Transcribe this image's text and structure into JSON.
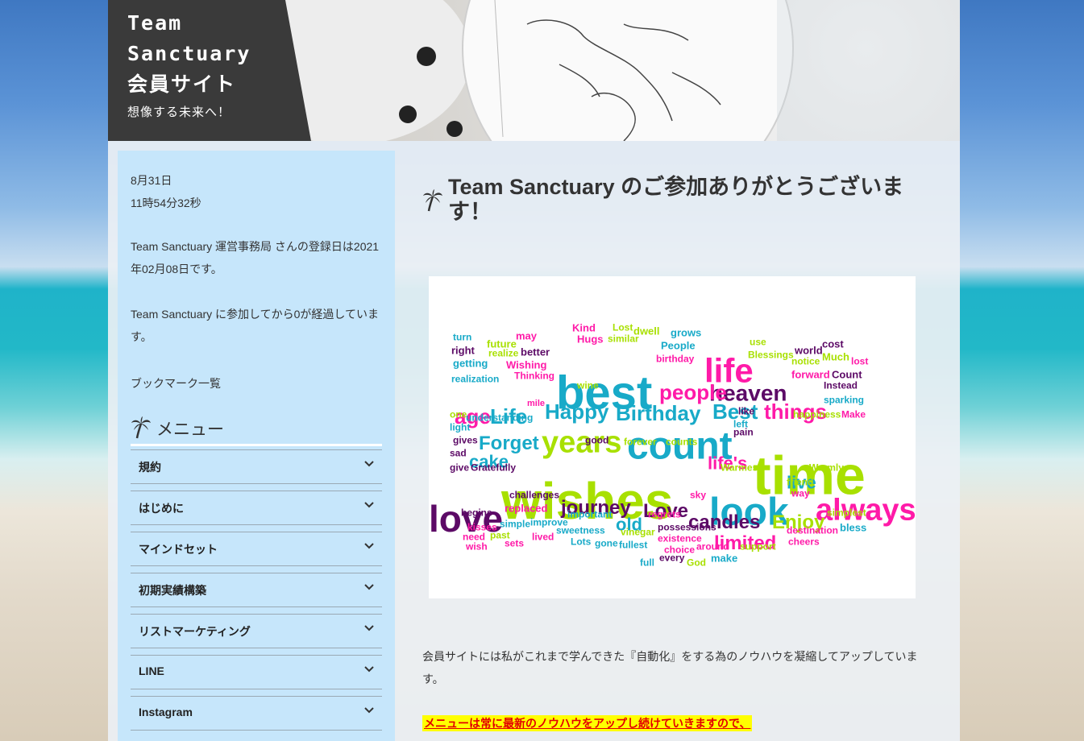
{
  "header": {
    "site_title": "Team\nSanctuary\n会員サイト",
    "tagline": "想像する未来へ！"
  },
  "sidebar": {
    "date": "8月31日",
    "time": "11時54分32秒",
    "registration": "Team Sanctuary 運営事務局 さんの登録日は2021年02月08日です。",
    "elapsed": "Team Sanctuary に参加してから0が経過しています。",
    "bookmarks": "ブックマーク一覧",
    "menu_heading": "メニュー",
    "menu_items": [
      {
        "label": "規約"
      },
      {
        "label": "はじめに"
      },
      {
        "label": "マインドセット"
      },
      {
        "label": "初期実績構築"
      },
      {
        "label": "リストマーケティング"
      },
      {
        "label": "LINE"
      },
      {
        "label": "Instagram"
      }
    ]
  },
  "main": {
    "post_title": "Team Sanctuary のご参加ありがとうございます！",
    "body": "会員サイトには私がこれまで学んできた『自動化』をする為のノウハウを凝縮してアップしています。",
    "highlight": "メニューは常に最新のノウハウをアップし続けていきますので、"
  },
  "wordcloud": {
    "words": [
      {
        "t": "wishes",
        "c": "#a8e000"
      },
      {
        "t": "time",
        "c": "#a8e000"
      },
      {
        "t": "best",
        "c": "#18aac8"
      },
      {
        "t": "love",
        "c": "#5c0a66"
      },
      {
        "t": "look",
        "c": "#18aac8"
      },
      {
        "t": "count",
        "c": "#18aac8"
      },
      {
        "t": "life",
        "c": "#ff1aa8"
      },
      {
        "t": "years",
        "c": "#a8e000"
      },
      {
        "t": "always",
        "c": "#ff1aa8"
      },
      {
        "t": "heaven",
        "c": "#5c0a66"
      },
      {
        "t": "people",
        "c": "#ff1aa8"
      },
      {
        "t": "Birthday",
        "c": "#18aac8"
      },
      {
        "t": "Happy",
        "c": "#18aac8"
      },
      {
        "t": "Best",
        "c": "#18aac8"
      },
      {
        "t": "things",
        "c": "#ff1aa8"
      },
      {
        "t": "age",
        "c": "#ff1aa8"
      },
      {
        "t": "Life",
        "c": "#18aac8"
      },
      {
        "t": "Forget",
        "c": "#18aac8"
      },
      {
        "t": "cake",
        "c": "#18aac8"
      },
      {
        "t": "journey",
        "c": "#5c0a66"
      },
      {
        "t": "Love",
        "c": "#5c0a66"
      },
      {
        "t": "candles",
        "c": "#5c0a66"
      },
      {
        "t": "Enjoy",
        "c": "#a8e000"
      },
      {
        "t": "limited",
        "c": "#ff1aa8"
      },
      {
        "t": "life's",
        "c": "#ff1aa8"
      },
      {
        "t": "live",
        "c": "#18aac8"
      },
      {
        "t": "old",
        "c": "#18aac8"
      },
      {
        "t": "lost",
        "c": "#ff1aa8"
      },
      {
        "t": "cost",
        "c": "#5c0a66"
      },
      {
        "t": "world",
        "c": "#5c0a66"
      },
      {
        "t": "Blessings",
        "c": "#a8e000"
      },
      {
        "t": "forward",
        "c": "#ff1aa8"
      },
      {
        "t": "Count",
        "c": "#5c0a66"
      },
      {
        "t": "Instead",
        "c": "#5c0a66"
      },
      {
        "t": "sparking",
        "c": "#18aac8"
      },
      {
        "t": "Make",
        "c": "#ff1aa8"
      },
      {
        "t": "Warmly",
        "c": "#a8e000"
      },
      {
        "t": "simplest",
        "c": "#a8e000"
      },
      {
        "t": "bless",
        "c": "#18aac8"
      },
      {
        "t": "destination",
        "c": "#ff1aa8"
      },
      {
        "t": "cheers",
        "c": "#ff1aa8"
      },
      {
        "t": "support",
        "c": "#a8e000"
      },
      {
        "t": "make",
        "c": "#18aac8"
      },
      {
        "t": "every",
        "c": "#5c0a66"
      },
      {
        "t": "God",
        "c": "#a8e000"
      },
      {
        "t": "full",
        "c": "#18aac8"
      },
      {
        "t": "fullest",
        "c": "#18aac8"
      },
      {
        "t": "gone",
        "c": "#18aac8"
      },
      {
        "t": "Lots",
        "c": "#18aac8"
      },
      {
        "t": "lived",
        "c": "#ff1aa8"
      },
      {
        "t": "sets",
        "c": "#ff1aa8"
      },
      {
        "t": "past",
        "c": "#a8e000"
      },
      {
        "t": "wish",
        "c": "#ff1aa8"
      },
      {
        "t": "need",
        "c": "#ff1aa8"
      },
      {
        "t": "kisses",
        "c": "#ff1aa8"
      },
      {
        "t": "begins",
        "c": "#5c0a66"
      },
      {
        "t": "challenges",
        "c": "#5c0a66"
      },
      {
        "t": "replaced",
        "c": "#ff1aa8"
      },
      {
        "t": "simple",
        "c": "#18aac8"
      },
      {
        "t": "improve",
        "c": "#18aac8"
      },
      {
        "t": "sweetness",
        "c": "#18aac8"
      },
      {
        "t": "important",
        "c": "#18aac8"
      },
      {
        "t": "vinegar",
        "c": "#a8e000"
      },
      {
        "t": "regrets",
        "c": "#ff1aa8"
      },
      {
        "t": "possessions",
        "c": "#5c0a66"
      },
      {
        "t": "existence",
        "c": "#ff1aa8"
      },
      {
        "t": "choice",
        "c": "#ff1aa8"
      },
      {
        "t": "around",
        "c": "#ff1aa8"
      },
      {
        "t": "sky",
        "c": "#ff1aa8"
      },
      {
        "t": "give",
        "c": "#5c0a66"
      },
      {
        "t": "Gratefully",
        "c": "#5c0a66"
      },
      {
        "t": "sad",
        "c": "#5c0a66"
      },
      {
        "t": "gives",
        "c": "#5c0a66"
      },
      {
        "t": "light",
        "c": "#18aac8"
      },
      {
        "t": "one",
        "c": "#a8e000"
      },
      {
        "t": "understanding",
        "c": "#18aac8"
      },
      {
        "t": "mile",
        "c": "#ff1aa8"
      },
      {
        "t": "good",
        "c": "#5c0a66"
      },
      {
        "t": "forever",
        "c": "#a8e000"
      },
      {
        "t": "counts",
        "c": "#a8e000"
      },
      {
        "t": "Warmest",
        "c": "#a8e000"
      },
      {
        "t": "friend",
        "c": "#a8e000"
      },
      {
        "t": "way",
        "c": "#ff1aa8"
      },
      {
        "t": "pain",
        "c": "#5c0a66"
      },
      {
        "t": "left",
        "c": "#18aac8"
      },
      {
        "t": "like",
        "c": "#5c0a66"
      },
      {
        "t": "happiness",
        "c": "#a8e000"
      },
      {
        "t": "Much",
        "c": "#a8e000"
      },
      {
        "t": "notice",
        "c": "#a8e000"
      },
      {
        "t": "use",
        "c": "#a8e000"
      },
      {
        "t": "wine",
        "c": "#a8e000"
      },
      {
        "t": "realization",
        "c": "#18aac8"
      },
      {
        "t": "Thinking",
        "c": "#ff1aa8"
      },
      {
        "t": "Wishing",
        "c": "#ff1aa8"
      },
      {
        "t": "getting",
        "c": "#18aac8"
      },
      {
        "t": "realize",
        "c": "#a8e000"
      },
      {
        "t": "right",
        "c": "#5c0a66"
      },
      {
        "t": "turn",
        "c": "#18aac8"
      },
      {
        "t": "future",
        "c": "#a8e000"
      },
      {
        "t": "better",
        "c": "#5c0a66"
      },
      {
        "t": "may",
        "c": "#ff1aa8"
      },
      {
        "t": "Kind",
        "c": "#ff1aa8"
      },
      {
        "t": "Hugs",
        "c": "#ff1aa8"
      },
      {
        "t": "Lost",
        "c": "#a8e000"
      },
      {
        "t": "dwell",
        "c": "#a8e000"
      },
      {
        "t": "similar",
        "c": "#a8e000"
      },
      {
        "t": "grows",
        "c": "#18aac8"
      },
      {
        "t": "People",
        "c": "#18aac8"
      },
      {
        "t": "birthday",
        "c": "#ff1aa8"
      }
    ]
  }
}
